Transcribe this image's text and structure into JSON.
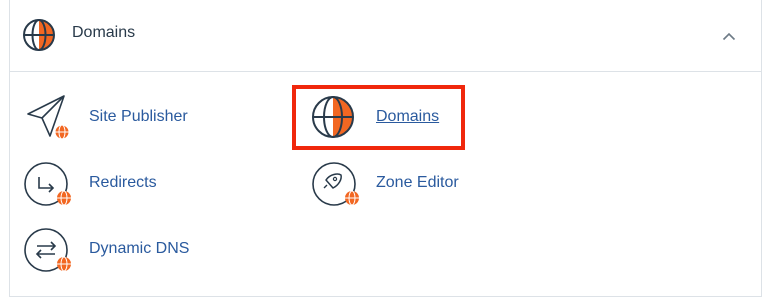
{
  "section": {
    "title": "Domains",
    "header_icon": "globe-icon",
    "toggle_icon": "chevron-up-icon"
  },
  "items": [
    {
      "label": "Site Publisher",
      "icon": "paper-plane-icon",
      "selected": false
    },
    {
      "label": "Domains",
      "icon": "globe-icon",
      "selected": true
    },
    {
      "label": "Redirects",
      "icon": "redirect-arrow-icon",
      "selected": false
    },
    {
      "label": "Zone Editor",
      "icon": "rocket-icon",
      "selected": false
    },
    {
      "label": "Dynamic DNS",
      "icon": "exchange-arrows-icon",
      "selected": false
    }
  ],
  "colors": {
    "accent_orange": "#f26722",
    "link_blue": "#2a5a9e",
    "highlight_red": "#f0270c",
    "icon_stroke": "#293a4a",
    "border": "#dde2e7"
  }
}
